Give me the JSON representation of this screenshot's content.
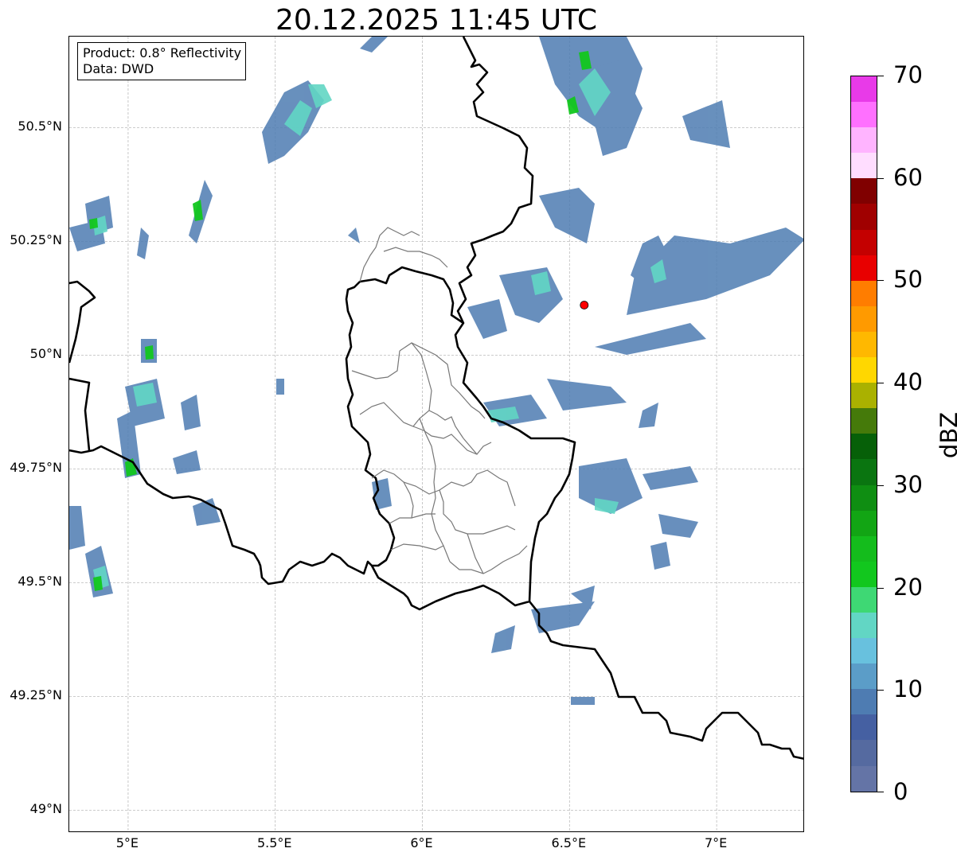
{
  "title": "20.12.2025 11:45 UTC",
  "info": {
    "product": "Product: 0.8° Reflectivity",
    "source": "Data: DWD"
  },
  "axes": {
    "lat_labels": [
      {
        "value": 50.5,
        "text": "50.5°N"
      },
      {
        "value": 50.25,
        "text": "50.25°N"
      },
      {
        "value": 50.0,
        "text": "50°N"
      },
      {
        "value": 49.75,
        "text": "49.75°N"
      },
      {
        "value": 49.5,
        "text": "49.5°N"
      },
      {
        "value": 49.25,
        "text": "49.25°N"
      },
      {
        "value": 49.0,
        "text": "49°N"
      }
    ],
    "lon_labels": [
      {
        "value": 5.0,
        "text": "5°E"
      },
      {
        "value": 5.5,
        "text": "5.5°E"
      },
      {
        "value": 6.0,
        "text": "6°E"
      },
      {
        "value": 6.5,
        "text": "6.5°E"
      },
      {
        "value": 7.0,
        "text": "7°E"
      }
    ],
    "lon_range": [
      4.8,
      7.3
    ],
    "lat_range": [
      48.95,
      50.7
    ],
    "grid": true
  },
  "radar_site": {
    "lon": 6.55,
    "lat": 50.11,
    "color": "#ff0000"
  },
  "colorbar": {
    "label": "dBZ",
    "ticks": [
      {
        "value": 0,
        "text": "0"
      },
      {
        "value": 10,
        "text": "10"
      },
      {
        "value": 20,
        "text": "20"
      },
      {
        "value": 30,
        "text": "30"
      },
      {
        "value": 40,
        "text": "40"
      },
      {
        "value": 50,
        "text": "50"
      },
      {
        "value": 60,
        "text": "60"
      },
      {
        "value": 70,
        "text": "70"
      }
    ],
    "colors": [
      "#6474a6",
      "#556aa0",
      "#4560a2",
      "#4e7cb2",
      "#5b9dc8",
      "#68c1de",
      "#62d6c4",
      "#3ed874",
      "#12c71e",
      "#14bc1c",
      "#12a514",
      "#0f8e12",
      "#0a7510",
      "#066008",
      "#457a0a",
      "#aab100",
      "#ffd700",
      "#ffb800",
      "#ff9a00",
      "#ff7d00",
      "#e80000",
      "#c40000",
      "#a00000",
      "#800000",
      "#ffddff",
      "#ffb4ff",
      "#ff70ff",
      "#e83ae8"
    ]
  }
}
